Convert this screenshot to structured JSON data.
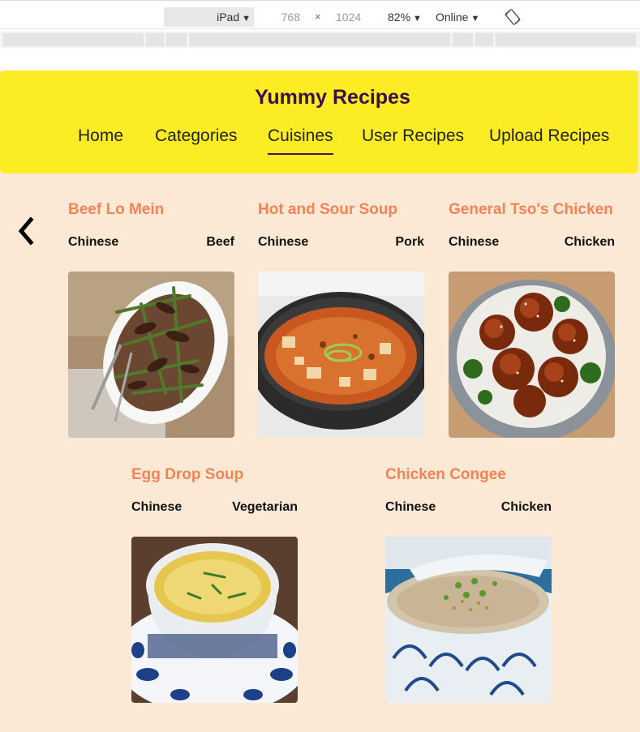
{
  "devtools": {
    "device": "iPad",
    "width": "768",
    "times": "×",
    "height": "1024",
    "zoom": "82%",
    "throttle": "Online"
  },
  "site": {
    "title": "Yummy Recipes",
    "nav": [
      {
        "label": "Home"
      },
      {
        "label": "Categories"
      },
      {
        "label": "Cuisines",
        "active": true
      },
      {
        "label": "User Recipes"
      },
      {
        "label": "Upload Recipes"
      }
    ]
  },
  "recipes": [
    {
      "title": "Beef Lo Mein",
      "cuisine": "Chinese",
      "category": "Beef"
    },
    {
      "title": "Hot and Sour Soup",
      "cuisine": "Chinese",
      "category": "Pork"
    },
    {
      "title": "General Tso's Chicken",
      "cuisine": "Chinese",
      "category": "Chicken"
    },
    {
      "title": "Egg Drop Soup",
      "cuisine": "Chinese",
      "category": "Vegetarian"
    },
    {
      "title": "Chicken Congee",
      "cuisine": "Chinese",
      "category": "Chicken"
    }
  ],
  "icons": {
    "prev": "chevron-left-icon",
    "rotate": "rotate-icon"
  },
  "colors": {
    "header_bg": "#fbec23",
    "title": "#3b0d4a",
    "page_bg": "#fbe9d6",
    "recipe_title": "#f48356"
  }
}
